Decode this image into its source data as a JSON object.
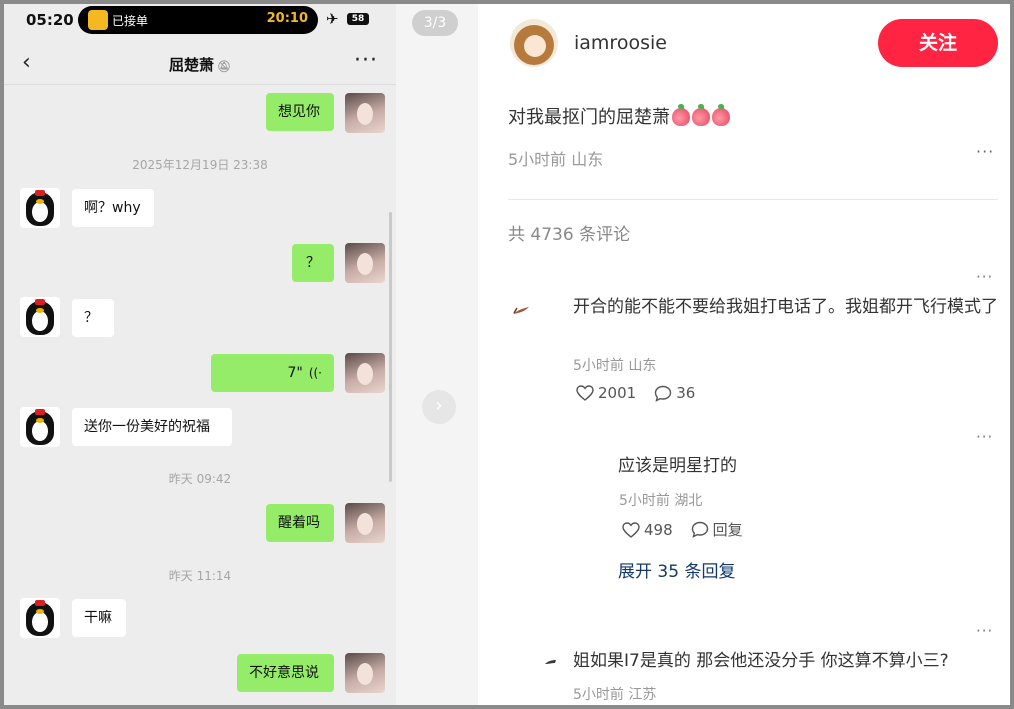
{
  "phone": {
    "status": {
      "time": "05:20",
      "island_label": "已接单",
      "island_time": "20:10",
      "battery": "58"
    },
    "nav": {
      "title": "屈楚萧"
    },
    "messages": [
      {
        "from": "me",
        "text": "想见你"
      },
      {
        "timestamp": "2025年12月19日 23:38"
      },
      {
        "from": "peer",
        "text": "啊？why"
      },
      {
        "from": "me",
        "text": "？"
      },
      {
        "from": "peer",
        "text": "？"
      },
      {
        "from": "me",
        "text": "7\"",
        "type": "voice"
      },
      {
        "from": "peer",
        "text": "送你一份美好的祝福"
      },
      {
        "timestamp": "昨天 09:42"
      },
      {
        "from": "me",
        "text": "醒着吗"
      },
      {
        "timestamp": "昨天 11:14"
      },
      {
        "from": "peer",
        "text": "干嘛"
      },
      {
        "from": "me",
        "text": "不好意思说"
      }
    ]
  },
  "gallery": {
    "page_indicator": "3/3"
  },
  "post": {
    "author": "iamroosie",
    "follow_label": "关注",
    "title": "对我最抠门的屈楚萧",
    "meta": "5小时前 山东",
    "comment_count": "共 4736 条评论",
    "comments": [
      {
        "text": "开合的能不能不要给我姐打电话了。我姐都开飞行模式了",
        "meta": "5小时前 山东",
        "likes": "2001",
        "replies": "36"
      },
      {
        "text": "应该是明星打的",
        "meta": "5小时前 湖北",
        "likes": "498",
        "replies": "回复",
        "is_reply": true
      },
      {
        "expand": "展开 35 条回复"
      },
      {
        "text": "姐如果I7是真的 那会他还没分手 你这算不算小三?",
        "meta": "5小时前 江苏"
      }
    ]
  },
  "colors": {
    "accent": "#ff2442",
    "bubble_me": "#95ec69",
    "link": "#13386c"
  }
}
